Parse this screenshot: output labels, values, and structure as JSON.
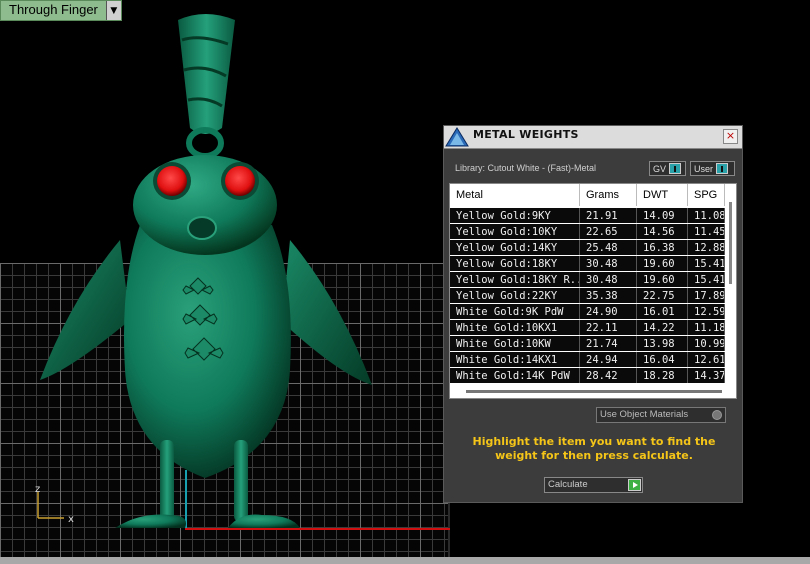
{
  "viewport": {
    "view_mode": "Through Finger",
    "axis_labels": {
      "x": "x",
      "z": "z"
    }
  },
  "dialog": {
    "title": "METAL WEIGHTS",
    "close_symbol": "×",
    "library_label": "Library: Cutout White - (Fast)-Metal",
    "toggle_gv": "GV",
    "toggle_user": "User",
    "table": {
      "headers": [
        "Metal",
        "Grams",
        "DWT",
        "SPG"
      ],
      "rows": [
        [
          "Yellow Gold:9KY",
          "21.91",
          "14.09",
          "11.08"
        ],
        [
          "Yellow Gold:10KY",
          "22.65",
          "14.56",
          "11.45"
        ],
        [
          "Yellow Gold:14KY",
          "25.48",
          "16.38",
          "12.88"
        ],
        [
          "Yellow Gold:18KY",
          "30.48",
          "19.60",
          "15.41"
        ],
        [
          "Yellow Gold:18KY R...",
          "30.48",
          "19.60",
          "15.41"
        ],
        [
          "Yellow Gold:22KY",
          "35.38",
          "22.75",
          "17.89"
        ],
        [
          "White Gold:9K PdW",
          "24.90",
          "16.01",
          "12.59"
        ],
        [
          "White Gold:10KX1",
          "22.11",
          "14.22",
          "11.18"
        ],
        [
          "White Gold:10KW",
          "21.74",
          "13.98",
          "10.99"
        ],
        [
          "White Gold:14KX1",
          "24.94",
          "16.04",
          "12.61"
        ],
        [
          "White Gold:14K PdW",
          "28.42",
          "18.28",
          "14.37"
        ]
      ]
    },
    "use_materials_label": "Use Object Materials",
    "instruction": "Highlight the item you want to find the weight for then press calculate.",
    "calculate_label": "Calculate"
  },
  "colors": {
    "model": "#0f7a5a",
    "eyes": "#e01010",
    "instruction_text": "#f5c518",
    "grid": "#3a3a3a",
    "axis_red": "#d01010",
    "axis_cyan": "#18a0b0"
  }
}
